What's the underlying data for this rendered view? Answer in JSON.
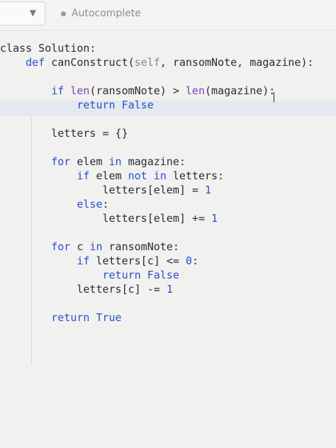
{
  "toolbar": {
    "language_label": "",
    "chevron_icon": "chevron-down-icon",
    "autocomplete_label": "Autocomplete"
  },
  "code": [
    {
      "tokens": [
        {
          "t": "class Solution:",
          "c": ""
        }
      ]
    },
    {
      "tokens": [
        {
          "t": "    ",
          "c": ""
        },
        {
          "t": "def",
          "c": "kw"
        },
        {
          "t": " canConstruct(",
          "c": ""
        },
        {
          "t": "self",
          "c": "slf"
        },
        {
          "t": ", ransomNote, magazine):",
          "c": ""
        }
      ]
    },
    {
      "tokens": [
        {
          "t": "",
          "c": ""
        }
      ]
    },
    {
      "tokens": [
        {
          "t": "        ",
          "c": ""
        },
        {
          "t": "if",
          "c": "kw"
        },
        {
          "t": " ",
          "c": ""
        },
        {
          "t": "len",
          "c": "bi"
        },
        {
          "t": "(ransomNote) > ",
          "c": ""
        },
        {
          "t": "len",
          "c": "bi"
        },
        {
          "t": "(magazine):",
          "c": ""
        }
      ]
    },
    {
      "tokens": [
        {
          "t": "            ",
          "c": ""
        },
        {
          "t": "return",
          "c": "kw"
        },
        {
          "t": " ",
          "c": ""
        },
        {
          "t": "False",
          "c": "kw"
        }
      ]
    },
    {
      "tokens": [
        {
          "t": "",
          "c": ""
        }
      ]
    },
    {
      "tokens": [
        {
          "t": "        letters = {}",
          "c": ""
        }
      ]
    },
    {
      "tokens": [
        {
          "t": "",
          "c": ""
        }
      ]
    },
    {
      "tokens": [
        {
          "t": "        ",
          "c": ""
        },
        {
          "t": "for",
          "c": "kw"
        },
        {
          "t": " elem ",
          "c": ""
        },
        {
          "t": "in",
          "c": "kw"
        },
        {
          "t": " magazine:",
          "c": ""
        }
      ]
    },
    {
      "tokens": [
        {
          "t": "            ",
          "c": ""
        },
        {
          "t": "if",
          "c": "kw"
        },
        {
          "t": " elem ",
          "c": ""
        },
        {
          "t": "not",
          "c": "kw"
        },
        {
          "t": " ",
          "c": ""
        },
        {
          "t": "in",
          "c": "kw"
        },
        {
          "t": " letters:",
          "c": ""
        }
      ]
    },
    {
      "tokens": [
        {
          "t": "                letters[elem] = ",
          "c": ""
        },
        {
          "t": "1",
          "c": "num"
        }
      ]
    },
    {
      "tokens": [
        {
          "t": "            ",
          "c": ""
        },
        {
          "t": "else",
          "c": "kw"
        },
        {
          "t": ":",
          "c": ""
        }
      ]
    },
    {
      "tokens": [
        {
          "t": "                letters[elem] += ",
          "c": ""
        },
        {
          "t": "1",
          "c": "num"
        }
      ]
    },
    {
      "tokens": [
        {
          "t": "",
          "c": ""
        }
      ]
    },
    {
      "tokens": [
        {
          "t": "        ",
          "c": ""
        },
        {
          "t": "for",
          "c": "kw"
        },
        {
          "t": " c ",
          "c": ""
        },
        {
          "t": "in",
          "c": "kw"
        },
        {
          "t": " ransomNote:",
          "c": ""
        }
      ]
    },
    {
      "tokens": [
        {
          "t": "            ",
          "c": ""
        },
        {
          "t": "if",
          "c": "kw"
        },
        {
          "t": " letters[c] <= ",
          "c": ""
        },
        {
          "t": "0",
          "c": "num"
        },
        {
          "t": ":",
          "c": ""
        }
      ]
    },
    {
      "tokens": [
        {
          "t": "                ",
          "c": ""
        },
        {
          "t": "return",
          "c": "kw"
        },
        {
          "t": " ",
          "c": ""
        },
        {
          "t": "False",
          "c": "kw"
        }
      ]
    },
    {
      "tokens": [
        {
          "t": "            letters[c] -= ",
          "c": ""
        },
        {
          "t": "1",
          "c": "num"
        }
      ]
    },
    {
      "tokens": [
        {
          "t": "",
          "c": ""
        }
      ]
    },
    {
      "tokens": [
        {
          "t": "        ",
          "c": ""
        },
        {
          "t": "return",
          "c": "kw"
        },
        {
          "t": " ",
          "c": ""
        },
        {
          "t": "True",
          "c": "kw"
        }
      ]
    }
  ]
}
